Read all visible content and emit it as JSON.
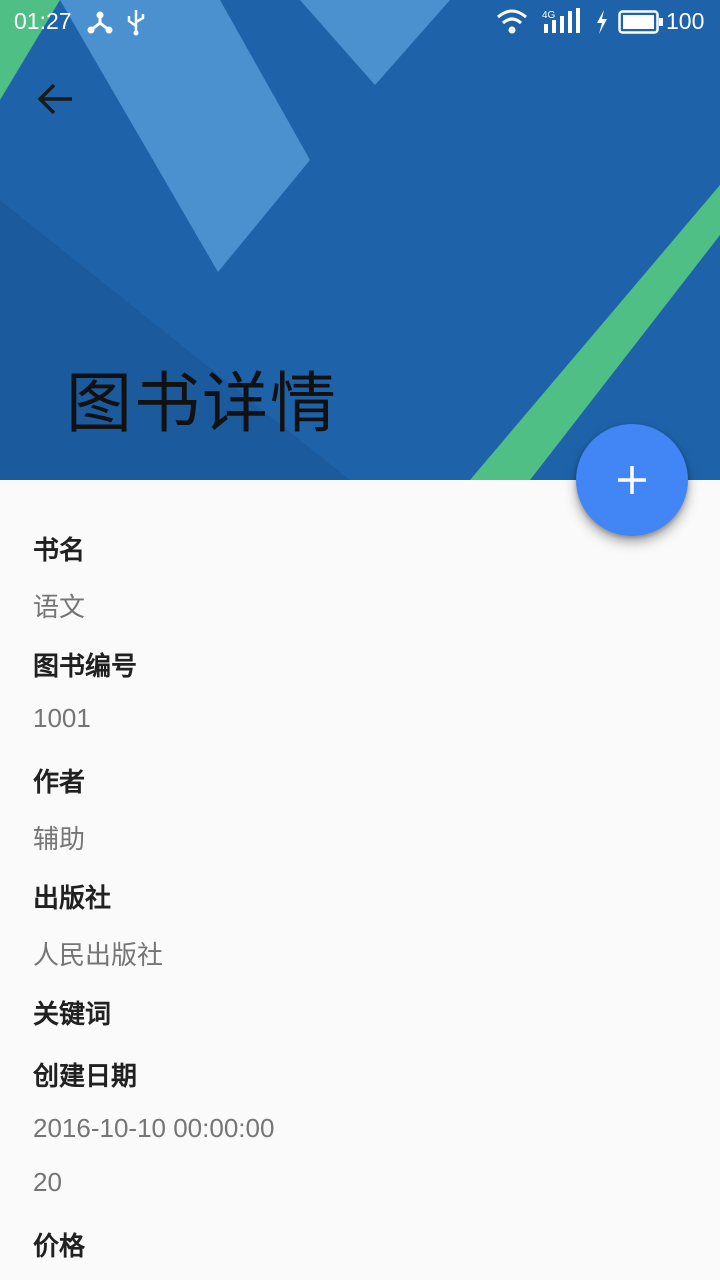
{
  "status_bar": {
    "time": "01:27",
    "icons": [
      "share-hub-icon",
      "usb-icon",
      "wifi-icon",
      "signal-4g-icon",
      "charging-icon",
      "battery-icon"
    ],
    "network": "4G",
    "battery": "100"
  },
  "header": {
    "title": "图书详情",
    "back_icon": "arrow-back-icon",
    "colors": {
      "base": "#1e63aa",
      "light": "#4b90cf",
      "accent": "#4fbf86"
    }
  },
  "fab": {
    "icon": "plus-icon",
    "color": "#4285f4"
  },
  "details": {
    "book_name": {
      "label": "书名",
      "value": "语文"
    },
    "book_number": {
      "label": "图书编号",
      "value": "1001"
    },
    "author": {
      "label": "作者",
      "value": "辅助"
    },
    "publisher": {
      "label": "出版社",
      "value": "人民出版社"
    },
    "keywords": {
      "label": "关键词"
    },
    "created_date": {
      "label": "创建日期",
      "value": "2016-10-10 00:00:00"
    },
    "extra_value": "20",
    "price": {
      "label": "价格"
    }
  }
}
